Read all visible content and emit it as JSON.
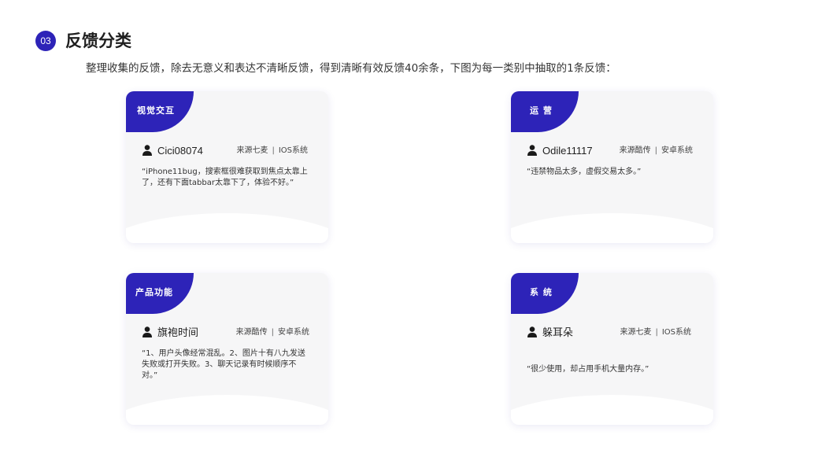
{
  "header": {
    "section_number": "03",
    "title": "反馈分类",
    "intro": "整理收集的反馈，除去无意义和表达不清晰反馈，得到清晰有效反馈40余条，下图为每一类别中抽取的1条反馈："
  },
  "cards": [
    {
      "category": "视觉交互",
      "user": "Cici08074",
      "source": "来源七麦",
      "system": "IOS系统",
      "quote": "“iPhone11bug，搜索框很难获取到焦点太靠上了，还有下面tabbar太靠下了，体验不好。”"
    },
    {
      "category": "运 营",
      "user": "Odile11117",
      "source": "来源酷传",
      "system": "安卓系统",
      "quote": "“违禁物品太多，虚假交易太多。”"
    },
    {
      "category": "产品功能",
      "user": "旗袍时间",
      "source": "来源酷传",
      "system": "安卓系统",
      "quote": "“1、用户头像经常混乱。2、图片十有八九发送失败或打开失败。3、聊天记录有时候顺序不对。”"
    },
    {
      "category": "系 统",
      "user": "躲耳朵",
      "source": "来源七麦",
      "system": "IOS系统",
      "quote": "“很少使用，却占用手机大量内存。”"
    }
  ],
  "colors": {
    "accent": "#2d23b8",
    "card_bg": "#f6f6f7"
  },
  "icons": {
    "user": "user-icon"
  }
}
